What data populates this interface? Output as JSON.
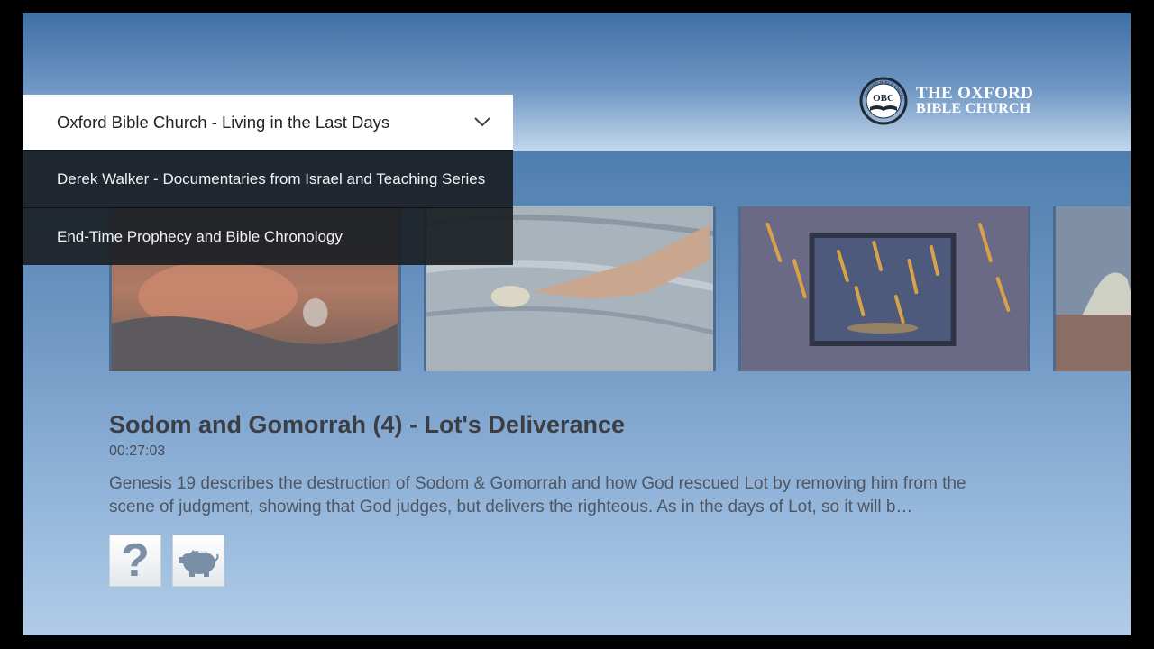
{
  "logo": {
    "line1": "THE OXFORD",
    "line2": "BIBLE CHURCH",
    "emblem_ring_text": "OXFORD BIBLE CHURCH",
    "emblem_initials": "OBC"
  },
  "channel_picker": {
    "selected": "Oxford Bible Church - Living in the Last Days",
    "options": [
      "Derek Walker - Documentaries from Israel and Teaching Series",
      "End-Time Prophecy and Bible Chronology"
    ]
  },
  "video": {
    "title": "Sodom and Gomorrah (4) - Lot's Deliverance",
    "duration": "00:27:03",
    "description": "Genesis 19 describes the destruction of Sodom & Gomorrah and how God rescued Lot by removing him from the scene of judgment, showing that God judges, but delivers the righteous. As in the days of Lot, so it will b…"
  },
  "actions": {
    "help_icon": "question-mark-icon",
    "donate_icon": "piggy-bank-icon"
  },
  "colors": {
    "accent_blue": "#5a85b3",
    "dropdown_bg": "#1c2026",
    "title_text": "#3b3f45"
  }
}
